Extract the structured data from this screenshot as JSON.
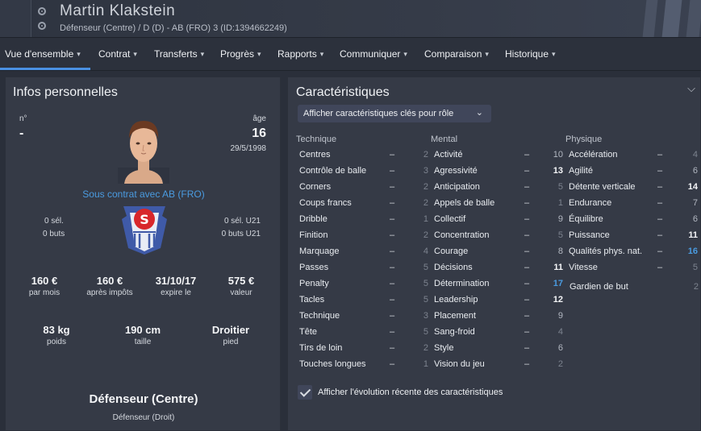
{
  "header": {
    "player_name": "Martin Klakstein",
    "subtitle": "Défenseur (Centre) / D (D) - AB (FRO) 3 (ID:1394662249)"
  },
  "nav": {
    "tabs": [
      {
        "label": "Vue d'ensemble"
      },
      {
        "label": "Contrat"
      },
      {
        "label": "Transferts"
      },
      {
        "label": "Progrès"
      },
      {
        "label": "Rapports"
      },
      {
        "label": "Communiquer"
      },
      {
        "label": "Comparaison"
      },
      {
        "label": "Historique"
      }
    ],
    "active_tab": "Vue d'ensemble"
  },
  "personal": {
    "title": "Infos personnelles",
    "number_label": "n°",
    "number_value": "-",
    "age_label": "âge",
    "age_value": "16",
    "birth_date": "29/5/1998",
    "contract_text": "Sous contrat avec AB (FRO)",
    "apps_sel": "0 sél.",
    "apps_buts": "0 buts",
    "apps_sel_u21": "0 sél. U21",
    "apps_buts_u21": "0 buts U21",
    "wage_value": "160 €",
    "wage_label": "par mois",
    "wage_net_value": "160 €",
    "wage_net_label": "après impôts",
    "expiry_value": "31/10/17",
    "expiry_label": "expire le",
    "market_value": "575 €",
    "market_label": "valeur",
    "weight_value": "83 kg",
    "weight_label": "poids",
    "height_value": "190 cm",
    "height_label": "taille",
    "foot_value": "Droitier",
    "foot_label": "pied",
    "position_main": "Défenseur (Centre)",
    "position_secondary": "Défenseur (Droit)"
  },
  "attributes": {
    "title": "Caractéristiques",
    "dropdown_label": "Afficher caractéristiques clés pour rôle",
    "checkbox_label": "Afficher l'évolution récente des caractéristiques",
    "checkbox_checked": true,
    "technique": {
      "header": "Technique",
      "items": [
        {
          "name": "Centres",
          "value": "2"
        },
        {
          "name": "Contrôle de balle",
          "value": "3"
        },
        {
          "name": "Corners",
          "value": "2"
        },
        {
          "name": "Coups francs",
          "value": "2"
        },
        {
          "name": "Dribble",
          "value": "1"
        },
        {
          "name": "Finition",
          "value": "2"
        },
        {
          "name": "Marquage",
          "value": "4"
        },
        {
          "name": "Passes",
          "value": "5"
        },
        {
          "name": "Penalty",
          "value": "5"
        },
        {
          "name": "Tacles",
          "value": "5"
        },
        {
          "name": "Technique",
          "value": "3"
        },
        {
          "name": "Tête",
          "value": "5"
        },
        {
          "name": "Tirs de loin",
          "value": "2"
        },
        {
          "name": "Touches longues",
          "value": "1"
        }
      ]
    },
    "mental": {
      "header": "Mental",
      "items": [
        {
          "name": "Activité",
          "value": "10"
        },
        {
          "name": "Agressivité",
          "value": "13"
        },
        {
          "name": "Anticipation",
          "value": "5"
        },
        {
          "name": "Appels de balle",
          "value": "1"
        },
        {
          "name": "Collectif",
          "value": "9"
        },
        {
          "name": "Concentration",
          "value": "5"
        },
        {
          "name": "Courage",
          "value": "8"
        },
        {
          "name": "Décisions",
          "value": "11"
        },
        {
          "name": "Détermination",
          "value": "17"
        },
        {
          "name": "Leadership",
          "value": "12"
        },
        {
          "name": "Placement",
          "value": "9"
        },
        {
          "name": "Sang-froid",
          "value": "4"
        },
        {
          "name": "Style",
          "value": "6"
        },
        {
          "name": "Vision du jeu",
          "value": "2"
        }
      ]
    },
    "physique": {
      "header": "Physique",
      "items": [
        {
          "name": "Accélération",
          "value": "4"
        },
        {
          "name": "Agilité",
          "value": "6"
        },
        {
          "name": "Détente verticale",
          "value": "14"
        },
        {
          "name": "Endurance",
          "value": "7"
        },
        {
          "name": "Équilibre",
          "value": "6"
        },
        {
          "name": "Puissance",
          "value": "11"
        },
        {
          "name": "Qualités phys. nat.",
          "value": "16"
        },
        {
          "name": "Vitesse",
          "value": "5"
        }
      ],
      "goalkeeper_label": "Gardien de but",
      "goalkeeper_value": "2"
    },
    "dash": "–"
  },
  "colors": {
    "accent": "#4a9be0",
    "background": "#2a2f3a",
    "panel": "#353a46"
  }
}
